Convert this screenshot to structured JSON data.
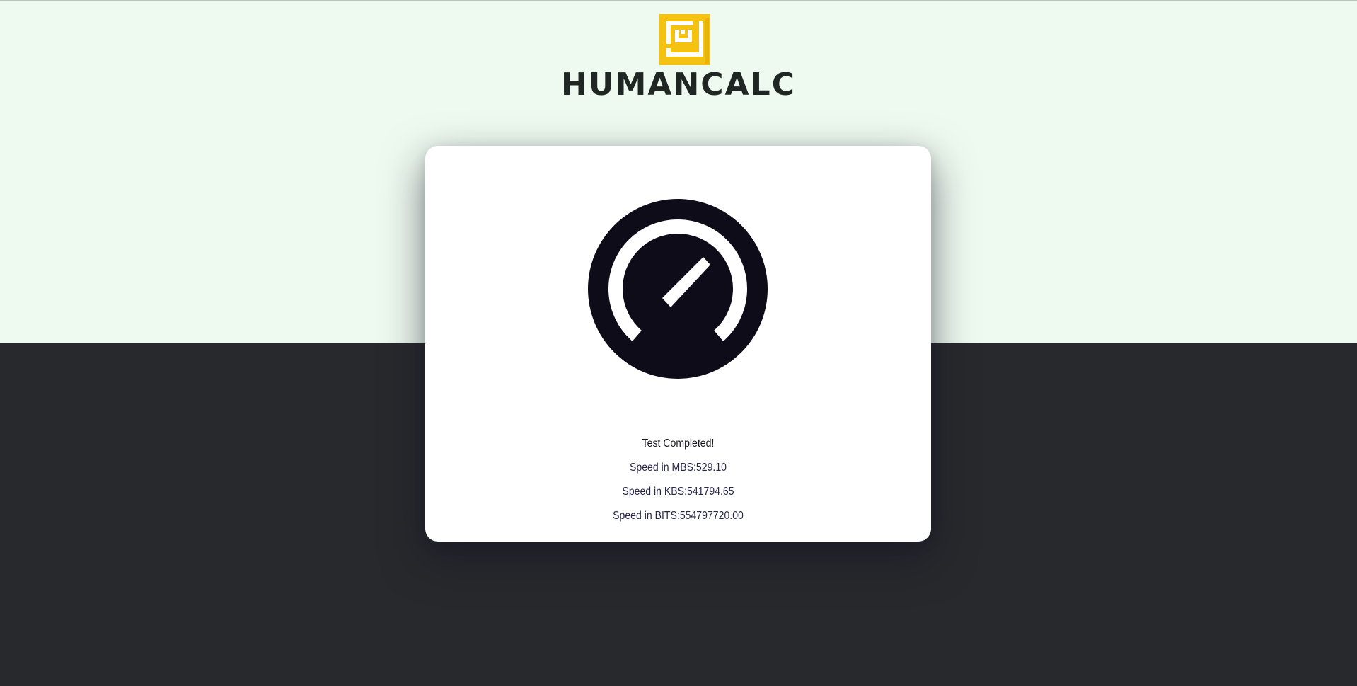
{
  "brand": {
    "name": "HUMANCALC",
    "logo_color": "#f5c211"
  },
  "result": {
    "status": "Test Completed!",
    "mbs": "Speed in MBS:529.10",
    "kbs": "Speed in KBS:541794.65",
    "bits": "Speed in BITS:554797720.00"
  },
  "colors": {
    "top_background": "#eefaef",
    "bottom_background": "#28292c",
    "card": "#ffffff",
    "gauge": "#0d0c18"
  },
  "icons": {
    "logo": "humancalc-logo-icon",
    "gauge": "speedometer-icon"
  }
}
